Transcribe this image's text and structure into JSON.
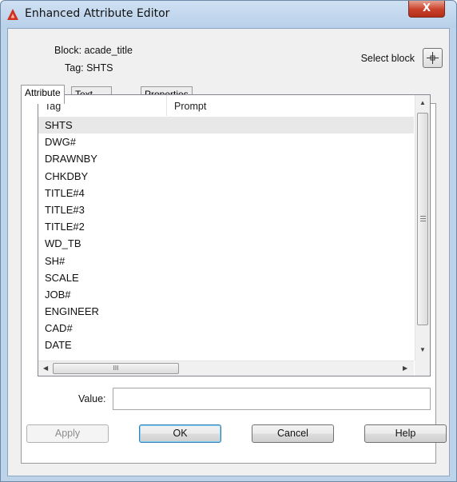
{
  "window": {
    "title": "Enhanced Attribute Editor",
    "close_label": "X"
  },
  "info": {
    "block_line": "Block: acade_title",
    "tag_line": "Tag: SHTS",
    "select_block_label": "Select block"
  },
  "tabs": [
    {
      "label": "Attribute",
      "active": true
    },
    {
      "label": "Text Options",
      "active": false
    },
    {
      "label": "Properties",
      "active": false
    }
  ],
  "attribute_list": {
    "columns": [
      "Tag",
      "Prompt"
    ],
    "rows": [
      "SHTS",
      "DWG#",
      "DRAWNBY",
      "CHKDBY",
      "TITLE#4",
      "TITLE#3",
      "TITLE#2",
      "WD_TB",
      "SH#",
      "SCALE",
      "JOB#",
      "ENGINEER",
      "CAD#",
      "DATE"
    ],
    "selected_row": "SHTS",
    "hscroll_thumb_glyph": "III"
  },
  "value_field": {
    "label": "Value:",
    "value": ""
  },
  "buttons": {
    "apply": "Apply",
    "ok": "OK",
    "cancel": "Cancel",
    "help": "Help"
  },
  "colors": {
    "titlebar": "#b8d0ea",
    "close_button": "#c8402a",
    "app_icon": "#d2301f",
    "selection": "#e8e8e8"
  },
  "icons": {
    "app": "autocad-a-icon",
    "select_block": "pick-crosshair-icon",
    "close": "close-icon"
  }
}
